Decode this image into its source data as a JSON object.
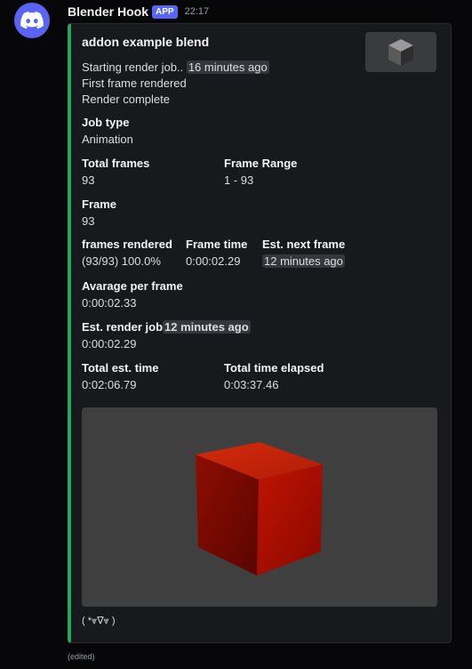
{
  "message": {
    "username": "Blender Hook",
    "badge": "APP",
    "timestamp": "22:17",
    "edited_label": "(edited)"
  },
  "embed": {
    "title": "addon example blend",
    "accent_color": "#23a55a",
    "description": {
      "line1_text": "Starting render job..",
      "line1_timestamp": "16 minutes ago",
      "line2": "First frame rendered",
      "line3": "Render complete"
    },
    "fields": {
      "job_type": {
        "name": "Job type",
        "value": "Animation"
      },
      "total_frames": {
        "name": "Total frames",
        "value": "93"
      },
      "frame_range": {
        "name": "Frame Range",
        "value": "1 - 93"
      },
      "frame": {
        "name": "Frame",
        "value": "93"
      },
      "frames_rendered": {
        "name": "frames rendered",
        "value": "(93/93) 100.0%"
      },
      "frame_time": {
        "name": "Frame time",
        "value": "0:00:02.29"
      },
      "est_next_frame": {
        "name": "Est. next frame",
        "value": "12 minutes ago"
      },
      "average_per_frame": {
        "name": "Avarage per frame",
        "value": "0:00:02.33"
      },
      "est_render_job": {
        "name": "Est. render job",
        "name_timestamp": "12 minutes ago",
        "value": "0:00:02.29"
      },
      "total_est_time": {
        "name": "Total est. time",
        "value": "0:02:06.79"
      },
      "total_time_elapsed": {
        "name": "Total time elapsed",
        "value": "0:03:37.46"
      }
    },
    "footer": "( *⩔∇⩔ )"
  },
  "icons": {
    "avatar": "discord-logo-icon",
    "thumbnail": "cube-thumbnail-icon",
    "render": "red-cube-render"
  },
  "colors": {
    "brand": "#5865f2",
    "embed_bg": "#18191c",
    "chip_bg": "#35373c",
    "render_bg": "#3f3f3f",
    "cube_red": "#b31200"
  }
}
